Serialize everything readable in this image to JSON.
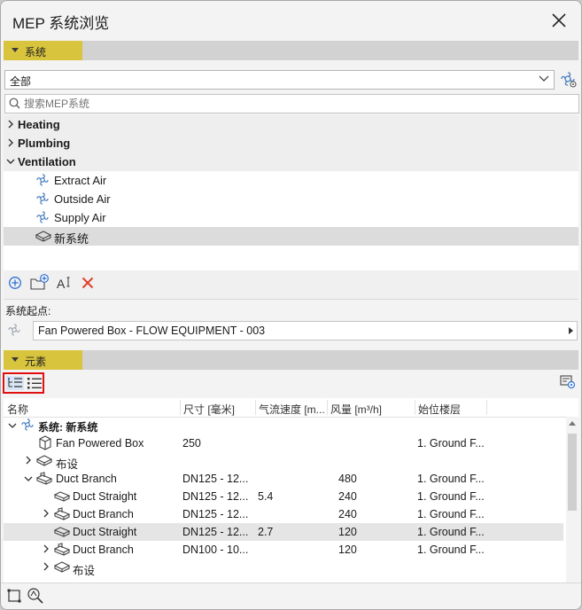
{
  "window": {
    "title": "MEP 系统浏览",
    "close_icon": "close-icon"
  },
  "systems_section": {
    "label": "系统"
  },
  "filter": {
    "value": "全部"
  },
  "search": {
    "placeholder": "搜索MEP系统"
  },
  "system_tree": [
    {
      "label": "Heating",
      "level": 0,
      "expanded": false
    },
    {
      "label": "Plumbing",
      "level": 0,
      "expanded": false
    },
    {
      "label": "Ventilation",
      "level": 0,
      "expanded": true
    },
    {
      "label": "Extract Air",
      "level": 1,
      "icon": "fan-icon"
    },
    {
      "label": "Outside Air",
      "level": 1,
      "icon": "fan-icon"
    },
    {
      "label": "Supply Air",
      "level": 1,
      "icon": "fan-icon"
    },
    {
      "label": "新系统",
      "level": 1,
      "icon": "box-icon",
      "selected": true
    }
  ],
  "system_start": {
    "label": "系统起点:",
    "value": "Fan Powered Box - FLOW EQUIPMENT - 003"
  },
  "elements_section": {
    "label": "元素"
  },
  "table": {
    "headers": [
      "名称",
      "尺寸 [毫米]",
      "气流速度 [m...",
      "风量 [m³/h]",
      "始位楼层"
    ],
    "rows": [
      {
        "name": "系统: 新系统",
        "size": "",
        "velocity": "",
        "flow": "",
        "floor": "",
        "indent": 0,
        "arrow": "down",
        "icon": "fan-icon",
        "bold": true
      },
      {
        "name": "Fan Powered Box",
        "size": "250",
        "velocity": "",
        "flow": "",
        "floor": "1. Ground F...",
        "indent": 2,
        "arrow": "",
        "icon": "equipment-icon"
      },
      {
        "name": "布设",
        "size": "",
        "velocity": "",
        "flow": "",
        "floor": "",
        "indent": 2,
        "arrow": "right",
        "icon": "route-icon"
      },
      {
        "name": "Duct Branch",
        "size": "DN125 - 12...",
        "velocity": "",
        "flow": "480",
        "floor": "1. Ground F...",
        "indent": 2,
        "arrow": "down",
        "icon": "branch-icon"
      },
      {
        "name": "Duct Straight",
        "size": "DN125 - 12...",
        "velocity": "5.4",
        "flow": "240",
        "floor": "1. Ground F...",
        "indent": 3,
        "arrow": "",
        "icon": "duct-icon"
      },
      {
        "name": "Duct Branch",
        "size": "DN125 - 12...",
        "velocity": "",
        "flow": "240",
        "floor": "1. Ground F...",
        "indent": 3,
        "arrow": "right",
        "icon": "branch-icon"
      },
      {
        "name": "Duct Straight",
        "size": "DN125 - 12...",
        "velocity": "2.7",
        "flow": "120",
        "floor": "1. Ground F...",
        "indent": 3,
        "arrow": "",
        "icon": "duct-icon",
        "selected": true
      },
      {
        "name": "Duct Branch",
        "size": "DN100 - 10...",
        "velocity": "",
        "flow": "120",
        "floor": "1. Ground F...",
        "indent": 3,
        "arrow": "right",
        "icon": "branch-icon"
      },
      {
        "name": "布设",
        "size": "",
        "velocity": "",
        "flow": "",
        "floor": "",
        "indent": 3,
        "arrow": "right",
        "icon": "route-icon"
      }
    ]
  },
  "colors": {
    "section_highlight": "#d8c43d",
    "delete": "#e0402a",
    "add": "#2b6fd6",
    "view_toggle_border": "#e01010"
  }
}
